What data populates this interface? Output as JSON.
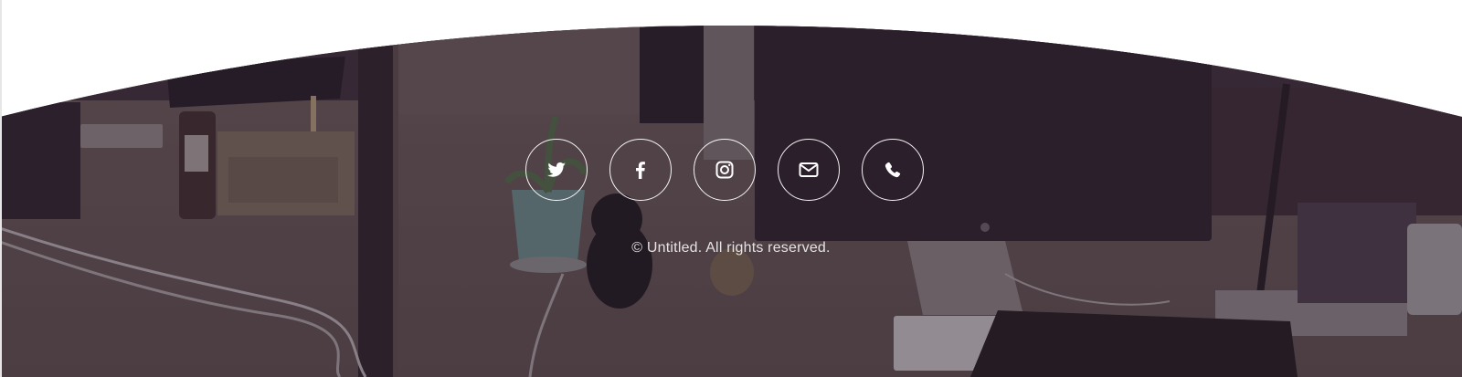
{
  "footer": {
    "copyright": "© Untitled. All rights reserved.",
    "social": [
      {
        "name": "twitter",
        "icon": "twitter-icon"
      },
      {
        "name": "facebook",
        "icon": "facebook-icon"
      },
      {
        "name": "instagram",
        "icon": "instagram-icon"
      },
      {
        "name": "email",
        "icon": "envelope-icon"
      },
      {
        "name": "phone",
        "icon": "phone-icon"
      }
    ]
  },
  "colors": {
    "overlay": "#2e2130",
    "text": "#ffffff"
  }
}
